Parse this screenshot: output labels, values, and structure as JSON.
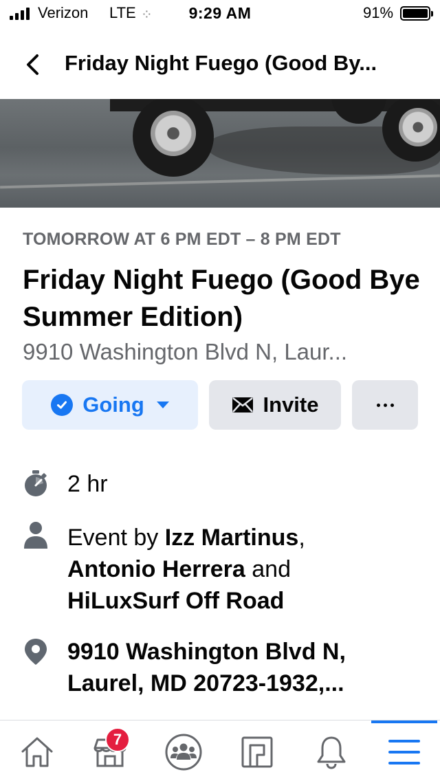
{
  "status_bar": {
    "carrier": "Verizon",
    "network": "LTE",
    "time": "9:29 AM",
    "battery_percent": "91%",
    "battery_level": 0.91,
    "signal_bars": 4
  },
  "header": {
    "back_icon": "chevron-left-icon",
    "title": "Friday Night Fuego (Good By..."
  },
  "event": {
    "date_time": "TOMORROW AT 6 PM EDT – 8 PM EDT",
    "title": "Friday Night Fuego (Good Bye Summer Edition)",
    "location_short": "9910 Washington Blvd N, Laur..."
  },
  "actions": {
    "going_label": "Going",
    "invite_label": "Invite",
    "more_icon": "more-dots-icon"
  },
  "details": {
    "duration": "2 hr",
    "hosts_prefix": "Event by ",
    "host_1": "Izz Martinus",
    "host_sep_1": ",",
    "host_2": "Antonio Herrera",
    "host_sep_2": " and ",
    "host_3": "HiLuxSurf Off Road",
    "address_line_1": "9910 Washington Blvd N,",
    "address_line_2": "Laurel, MD 20723-1932,..."
  },
  "tabbar": {
    "items": [
      {
        "name": "home",
        "icon": "home-icon"
      },
      {
        "name": "marketplace",
        "icon": "marketplace-icon",
        "badge": "7"
      },
      {
        "name": "groups",
        "icon": "groups-icon"
      },
      {
        "name": "pages",
        "icon": "pages-icon"
      },
      {
        "name": "notifications",
        "icon": "bell-icon"
      },
      {
        "name": "menu",
        "icon": "menu-icon",
        "active": true
      }
    ]
  },
  "colors": {
    "accent": "#1877f2",
    "going_bg": "#e7f0fd",
    "secondary_btn_bg": "#e4e6eb",
    "muted_text": "#65676b",
    "badge": "#e41e3f"
  }
}
